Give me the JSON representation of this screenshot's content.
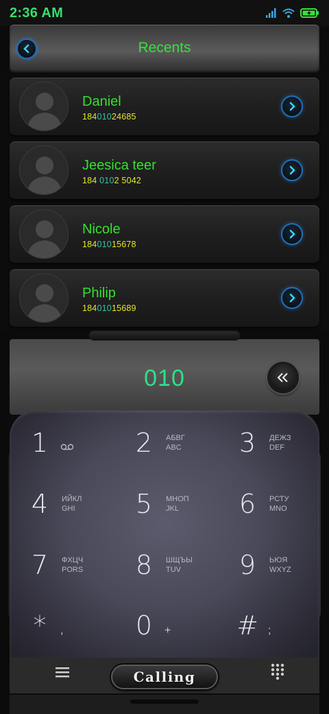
{
  "status_bar": {
    "time": "2:36 AM",
    "icons": [
      "signal-icon",
      "wifi-icon",
      "battery-charging-icon"
    ]
  },
  "header": {
    "title": "Recents",
    "back_icon": "chevron-left-icon"
  },
  "recents": [
    {
      "name": "Daniel",
      "number_pre": "184",
      "number_match": "010",
      "number_post": "24685"
    },
    {
      "name": "Jeesica teer",
      "number_pre": "184 ",
      "number_match": "010",
      "number_post": "2 5042"
    },
    {
      "name": "Nicole",
      "number_pre": "184",
      "number_match": "010",
      "number_post": "15678"
    },
    {
      "name": "Philip",
      "number_pre": "184",
      "number_match": "010",
      "number_post": "15689"
    }
  ],
  "dialer": {
    "input_value": "010"
  },
  "keypad": [
    {
      "digit": "1",
      "line1": "",
      "line2": "voicemail"
    },
    {
      "digit": "2",
      "line1": "АБВГ",
      "line2": "ABC"
    },
    {
      "digit": "3",
      "line1": "ДЕЖЗ",
      "line2": "DEF"
    },
    {
      "digit": "4",
      "line1": "ИЙКЛ",
      "line2": "GHI"
    },
    {
      "digit": "5",
      "line1": "МНОП",
      "line2": "JKL"
    },
    {
      "digit": "6",
      "line1": "РСТУ",
      "line2": "MNO"
    },
    {
      "digit": "7",
      "line1": "ФХЦЧ",
      "line2": "PORS"
    },
    {
      "digit": "8",
      "line1": "ШЩЪЫ",
      "line2": "TUV"
    },
    {
      "digit": "9",
      "line1": "ЬЮЯ",
      "line2": "WXYZ"
    },
    {
      "digit": "*",
      "sub": ","
    },
    {
      "digit": "0",
      "sub": "+"
    },
    {
      "digit": "#",
      "sub": ";"
    }
  ],
  "bottom_bar": {
    "calling_label": "Calling",
    "left_icon": "menu-icon",
    "right_icon": "dialpad-grid-icon"
  },
  "colors": {
    "accent_green": "#35e02f",
    "number_yellow": "#e6e62a",
    "number_match": "#39c0a8",
    "display_green": "#2fe08a",
    "ring_blue": "#1f6fb8"
  }
}
